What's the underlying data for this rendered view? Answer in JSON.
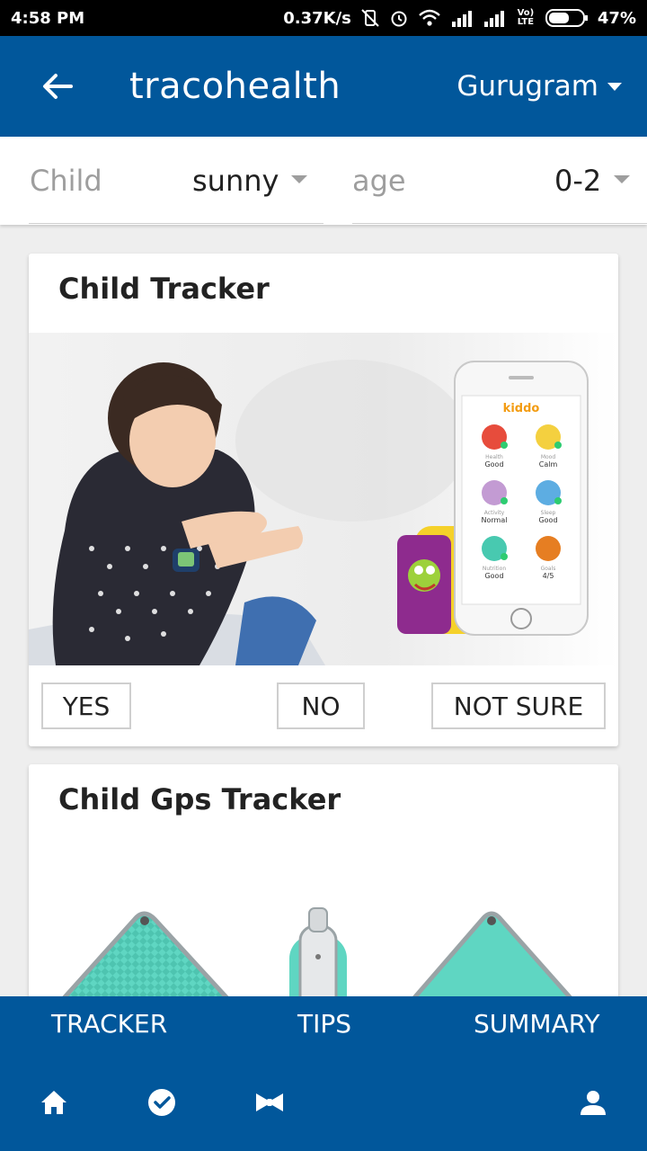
{
  "status_bar": {
    "time": "4:58 PM",
    "speed": "0.37K/s",
    "volte": "Vo) LTE",
    "battery": "47%"
  },
  "app_bar": {
    "title": "tracohealth",
    "city": "Gurugram"
  },
  "filters": {
    "child_label": "Child",
    "child_value": "sunny",
    "age_label": "age",
    "age_value": "0-2"
  },
  "cards": [
    {
      "title": "Child Tracker",
      "app_name": "kiddo",
      "app_tiles": [
        {
          "label": "Health",
          "value": "Good"
        },
        {
          "label": "Mood",
          "value": "Calm"
        },
        {
          "label": "Activity",
          "value": "Normal"
        },
        {
          "label": "Sleep",
          "value": "Good"
        },
        {
          "label": "Nutrition",
          "value": "Good"
        },
        {
          "label": "Goals",
          "value": "4/5"
        }
      ],
      "options": [
        "YES",
        "NO",
        "NOT SURE"
      ]
    },
    {
      "title": "Child Gps Tracker"
    }
  ],
  "bottom_nav": {
    "tabs": [
      "TRACKER",
      "TIPS",
      "SUMMARY"
    ],
    "icons": [
      "home-icon",
      "check-circle-icon",
      "bow-tie-icon",
      "person-icon"
    ]
  },
  "colors": {
    "primary": "#01579b",
    "status_bar": "#000000",
    "background": "#eeeeee",
    "card": "#ffffff",
    "device_teal": "#5fd6c2",
    "watch_yellow": "#f5d12a",
    "watch_purple": "#8e2b8e"
  }
}
